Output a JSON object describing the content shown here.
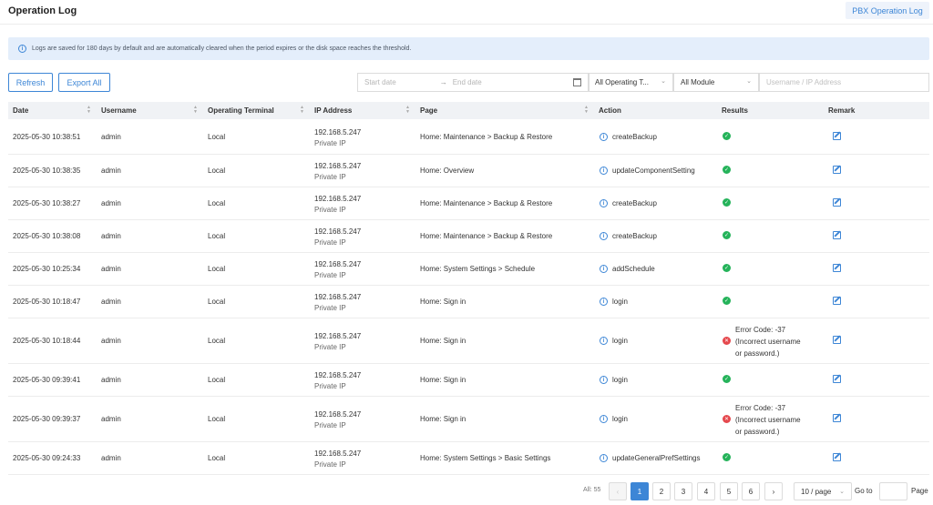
{
  "header": {
    "title": "Operation Log",
    "pbx_button": "PBX Operation Log"
  },
  "notice": {
    "text": "Logs are saved for 180 days by default and are automatically cleared when the period expires or the disk space reaches the threshold."
  },
  "toolbar": {
    "refresh": "Refresh",
    "export_all": "Export All"
  },
  "filters": {
    "start_date": "Start date",
    "end_date": "End date",
    "terminal": "All Operating T...",
    "module": "All Module",
    "search_placeholder": "Username / IP Address"
  },
  "columns": [
    "Date",
    "Username",
    "Operating Terminal",
    "IP Address",
    "Page",
    "Action",
    "Results",
    "Remark"
  ],
  "rows": [
    {
      "date": "2025-05-30 10:38:51",
      "user": "admin",
      "terminal": "Local",
      "ip": "192.168.5.247",
      "ip_type": "Private IP",
      "page": "Home:  Maintenance > Backup & Restore",
      "action": "createBackup",
      "result": "ok"
    },
    {
      "date": "2025-05-30 10:38:35",
      "user": "admin",
      "terminal": "Local",
      "ip": "192.168.5.247",
      "ip_type": "Private IP",
      "page": "Home:  Overview",
      "action": "updateComponentSetting",
      "result": "ok"
    },
    {
      "date": "2025-05-30 10:38:27",
      "user": "admin",
      "terminal": "Local",
      "ip": "192.168.5.247",
      "ip_type": "Private IP",
      "page": "Home:  Maintenance > Backup & Restore",
      "action": "createBackup",
      "result": "ok"
    },
    {
      "date": "2025-05-30 10:38:08",
      "user": "admin",
      "terminal": "Local",
      "ip": "192.168.5.247",
      "ip_type": "Private IP",
      "page": "Home:  Maintenance > Backup & Restore",
      "action": "createBackup",
      "result": "ok"
    },
    {
      "date": "2025-05-30 10:25:34",
      "user": "admin",
      "terminal": "Local",
      "ip": "192.168.5.247",
      "ip_type": "Private IP",
      "page": "Home:  System Settings > Schedule",
      "action": "addSchedule",
      "result": "ok"
    },
    {
      "date": "2025-05-30 10:18:47",
      "user": "admin",
      "terminal": "Local",
      "ip": "192.168.5.247",
      "ip_type": "Private IP",
      "page": "Home:  Sign in",
      "action": "login",
      "result": "ok"
    },
    {
      "date": "2025-05-30 10:18:44",
      "user": "admin",
      "terminal": "Local",
      "ip": "192.168.5.247",
      "ip_type": "Private IP",
      "page": "Home:  Sign in",
      "action": "login",
      "result": "error",
      "error_lines": [
        "Error Code: -37",
        "(Incorrect username",
        "or password.)"
      ]
    },
    {
      "date": "2025-05-30 09:39:41",
      "user": "admin",
      "terminal": "Local",
      "ip": "192.168.5.247",
      "ip_type": "Private IP",
      "page": "Home:  Sign in",
      "action": "login",
      "result": "ok"
    },
    {
      "date": "2025-05-30 09:39:37",
      "user": "admin",
      "terminal": "Local",
      "ip": "192.168.5.247",
      "ip_type": "Private IP",
      "page": "Home:  Sign in",
      "action": "login",
      "result": "error",
      "error_lines": [
        "Error Code: -37",
        "(Incorrect username",
        "or password.)"
      ]
    },
    {
      "date": "2025-05-30 09:24:33",
      "user": "admin",
      "terminal": "Local",
      "ip": "192.168.5.247",
      "ip_type": "Private IP",
      "page": "Home:  System Settings > Basic Settings",
      "action": "updateGeneralPrefSettings",
      "result": "ok"
    }
  ],
  "pagination": {
    "total": "All: 55",
    "pages": [
      "1",
      "2",
      "3",
      "4",
      "5",
      "6"
    ],
    "current": "1",
    "page_size": "10 / page",
    "goto_label": "Go to",
    "page_label": "Page"
  },
  "colors": {
    "accent": "#3d86d6",
    "success": "#25b35a",
    "error": "#e5484d",
    "header_bg": "#f0f2f5",
    "notice_bg": "#e4eefb"
  }
}
